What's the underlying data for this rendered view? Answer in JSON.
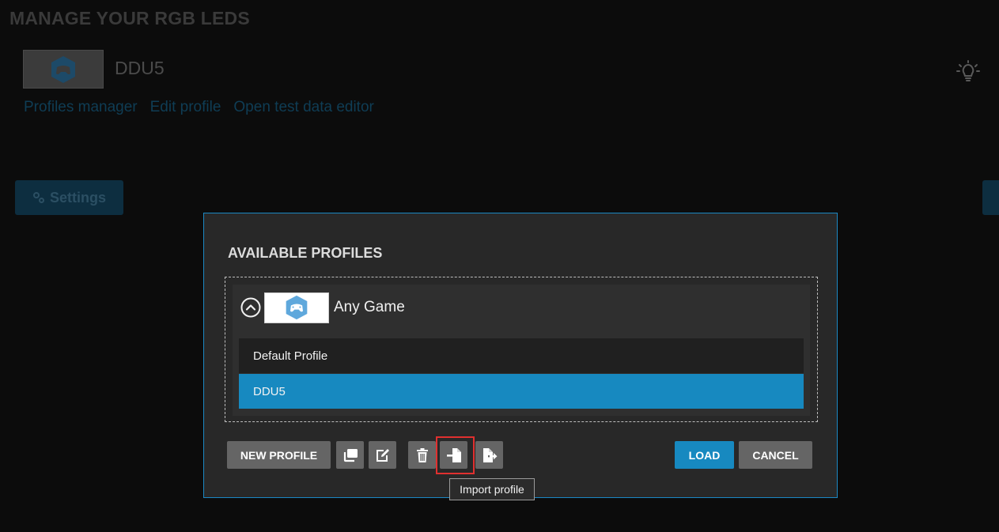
{
  "page": {
    "title": "MANAGE YOUR RGB LEDS",
    "device_name": "DDU5",
    "links": [
      "Profiles manager",
      "Edit profile",
      "Open test data editor"
    ],
    "settings_label": "Settings"
  },
  "dialog": {
    "title": "AVAILABLE PROFILES",
    "group": {
      "name": "Any Game",
      "expanded": true,
      "profiles": [
        {
          "label": "Default Profile",
          "selected": false
        },
        {
          "label": "DDU5",
          "selected": true
        }
      ]
    },
    "toolbar": {
      "new_profile_label": "NEW PROFILE",
      "duplicate_icon": "duplicate-icon",
      "edit_icon": "edit-icon",
      "delete_icon": "trash-icon",
      "import_icon": "import-icon",
      "export_icon": "export-icon",
      "load_label": "LOAD",
      "cancel_label": "CANCEL"
    },
    "tooltip": "Import profile"
  },
  "colors": {
    "accent": "#1789c0",
    "dialog_bg": "#282828",
    "button_bg": "#656565",
    "highlight": "#e0302f"
  }
}
